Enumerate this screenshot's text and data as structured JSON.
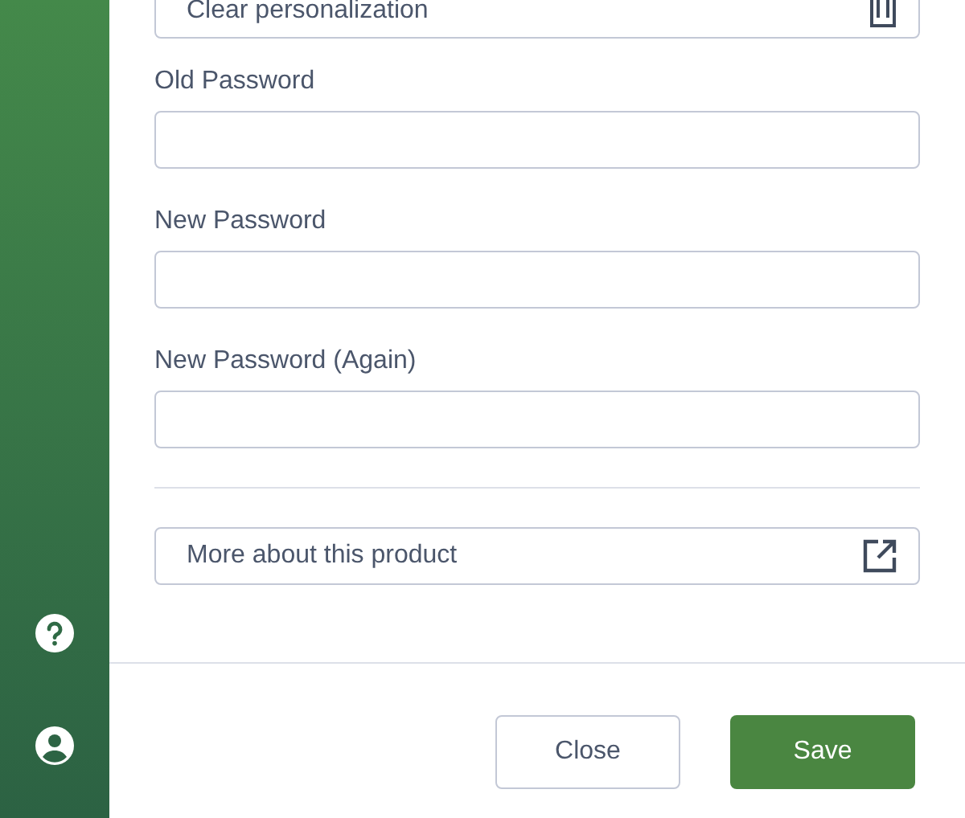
{
  "clear_button": {
    "label": "Clear personalization"
  },
  "fields": [
    {
      "label": "Old Password"
    },
    {
      "label": "New Password"
    },
    {
      "label": "New Password (Again)"
    }
  ],
  "more_button": {
    "label": "More about this product"
  },
  "footer_buttons": [
    {
      "label": "Close",
      "kind": "secondary"
    },
    {
      "label": "Save",
      "kind": "primary"
    }
  ]
}
